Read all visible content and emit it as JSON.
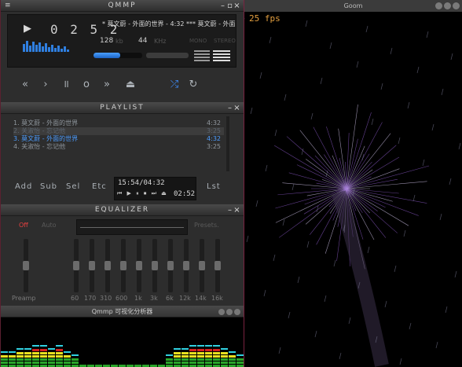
{
  "main": {
    "title": "QMMP",
    "timer": "0 2 5 2",
    "ticker": "* 莫文蔚 - 外面的世界 - 4:32  *** 莫文蔚 - 外面",
    "bitrate": "128",
    "bitrate_unit": "kb",
    "samplerate": "44",
    "samplerate_unit": "KHz",
    "mono": "MONO",
    "stereo": "STEREO",
    "seek_progress": 0.55,
    "mini_spectrum": [
      10,
      14,
      8,
      13,
      9,
      12,
      7,
      11,
      6,
      9,
      5,
      8,
      4,
      7,
      3
    ],
    "controls": {
      "prev": "«",
      "play": "›",
      "pause": "॥",
      "stop": "o",
      "next": "»",
      "eject": "⏏",
      "shuffle": "⤮",
      "repeat": "↻"
    }
  },
  "playlist": {
    "title": "PLAYLIST",
    "items": [
      {
        "label": "1. 莫文蔚 - 外面的世界",
        "duration": "4:32"
      },
      {
        "label": "2. 关淑怡 - 忘记他",
        "duration": "3:25"
      },
      {
        "label": "3. 莫文蔚 - 外面的世界",
        "duration": "4:32"
      },
      {
        "label": "4. 关淑怡 - 忘记他",
        "duration": "3:25"
      }
    ],
    "buttons": {
      "add": "Add",
      "sub": "Sub",
      "sel": "Sel",
      "etc": "Etc",
      "lst": "Lst"
    },
    "time": "15:54/04:32",
    "mini_controls": "⏮ ▶ ⏸ ⏹ ⏭ ⏏",
    "remaining": "02:52"
  },
  "equalizer": {
    "title": "EQUALIZER",
    "off": "Off",
    "auto": "Auto",
    "presets": "Presets",
    "preamp": "Preamp",
    "bands": [
      "60",
      "170",
      "310",
      "600",
      "1k",
      "3k",
      "6k",
      "12k",
      "14k",
      "16k"
    ]
  },
  "visualizer": {
    "title": "Qmmp 可视化分析器",
    "colors": {
      "green": "#2aa52a",
      "yellow": "#e8e020",
      "red": "#d42020",
      "cyan": "#30d0e0"
    }
  },
  "goom": {
    "title": "Goom",
    "fps": "25 fps"
  }
}
